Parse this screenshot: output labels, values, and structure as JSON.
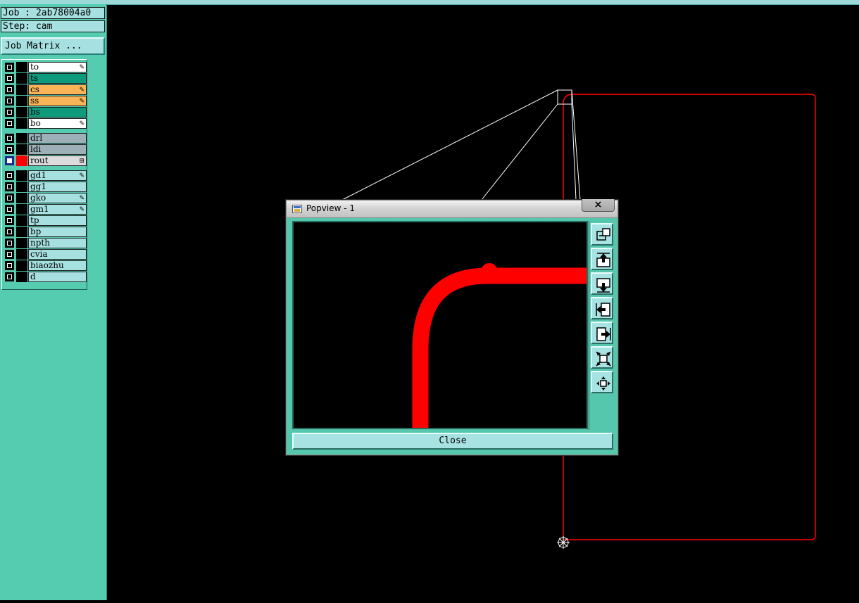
{
  "job_info": {
    "job": "Job : 2ab78004a0",
    "step": "Step: cam"
  },
  "job_matrix_button": {
    "label": "Job Matrix ..."
  },
  "layers": [
    {
      "name": "to",
      "color": "#ffffff",
      "flag": "✎"
    },
    {
      "name": "ts",
      "color": "#0e9a7c",
      "flag": ""
    },
    {
      "name": "cs",
      "color": "#f9b458",
      "flag": "✎"
    },
    {
      "name": "ss",
      "color": "#f9b458",
      "flag": "✎"
    },
    {
      "name": "bs",
      "color": "#0e9a7c",
      "flag": ""
    },
    {
      "name": "bo",
      "color": "#ffffff",
      "flag": "✎"
    },
    {
      "name": "drl",
      "color": "#9db0b8",
      "flag": ""
    },
    {
      "name": "ldi",
      "color": "#9db0b8",
      "flag": ""
    },
    {
      "name": "rout",
      "color": "#dcdcdc",
      "flag": "⊞",
      "active": true
    },
    {
      "name": "gd1",
      "color": "#a6e0e0",
      "flag": "✎"
    },
    {
      "name": "gg1",
      "color": "#a6e0e0",
      "flag": ""
    },
    {
      "name": "gko",
      "color": "#a6e0e0",
      "flag": "✎"
    },
    {
      "name": "gm1",
      "color": "#a6e0e0",
      "flag": "✎"
    },
    {
      "name": "tp",
      "color": "#a6e0e0",
      "flag": ""
    },
    {
      "name": "bp",
      "color": "#a6e0e0",
      "flag": ""
    },
    {
      "name": "npth",
      "color": "#a6e0e0",
      "flag": ""
    },
    {
      "name": "cvia",
      "color": "#a6e0e0",
      "flag": ""
    },
    {
      "name": "biaozhu",
      "color": "#a6e0e0",
      "flag": ""
    },
    {
      "name": "d",
      "color": "#a6e0e0",
      "flag": ""
    }
  ],
  "active_layer_color": "#ff0000",
  "popview": {
    "title": "Popview - 1",
    "close_x": "×",
    "close_label": "Close",
    "tools": [
      {
        "name": "popview-fit-icon"
      },
      {
        "name": "pan-up-icon"
      },
      {
        "name": "pan-down-icon"
      },
      {
        "name": "pan-left-icon"
      },
      {
        "name": "pan-right-icon"
      },
      {
        "name": "zoom-out-icon"
      },
      {
        "name": "zoom-in-icon"
      }
    ]
  },
  "colors": {
    "panel": "#55cbb0",
    "button": "#a6e0e0",
    "rout": "#ff0000",
    "canvas": "#000000"
  }
}
